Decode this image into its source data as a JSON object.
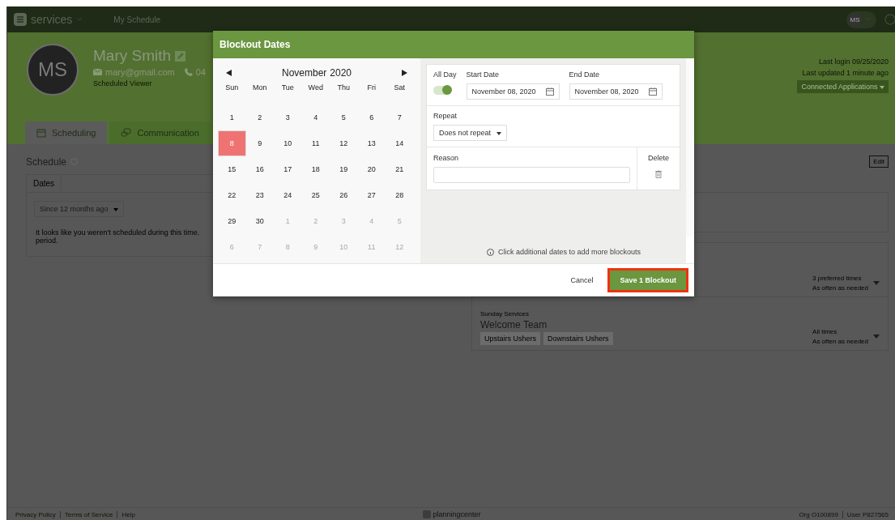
{
  "nav": {
    "app_name": "services",
    "link": "My Schedule",
    "avatar": "MS"
  },
  "profile": {
    "initials": "MS",
    "name": "Mary Smith",
    "email": "mary@gmail.com",
    "phone": "04",
    "role": "Scheduled Viewer",
    "last_login": "Last login 09/25/2020",
    "last_updated": "Last updated 1 minute ago",
    "apps_button": "Connected Applications"
  },
  "tabs": [
    {
      "label": "Scheduling",
      "selected": true
    },
    {
      "label": "Communication",
      "selected": false
    }
  ],
  "schedule": {
    "title": "Schedule",
    "edit": "Edit",
    "dates_tab": "Dates",
    "range": "Since 12 months ago",
    "empty_lines": [
      "It looks like you weren't scheduled during this time.",
      "period."
    ]
  },
  "teams": [
    {
      "times": "3 preferred times",
      "frequency": "As often as needed"
    },
    {
      "service": "Sunday Services",
      "name": "Welcome Team",
      "positions": [
        "Upstairs Ushers",
        "Downstairs Ushers"
      ],
      "times": "All times",
      "frequency": "As often as needed"
    }
  ],
  "footer": {
    "links": [
      "Privacy Policy",
      "Terms of Service",
      "Help"
    ],
    "brand": "planningcenter",
    "org": "Org O100899",
    "user": "User P827565"
  },
  "modal": {
    "title": "Blockout Dates",
    "calendar": {
      "month": "November",
      "year": "2020",
      "weekdays": [
        "Sun",
        "Mon",
        "Tue",
        "Wed",
        "Thu",
        "Fri",
        "Sat"
      ],
      "weeks": [
        [
          {
            "label": "1",
            "muted": false,
            "selected": false
          },
          {
            "label": "2",
            "muted": false,
            "selected": false
          },
          {
            "label": "3",
            "muted": false,
            "selected": false
          },
          {
            "label": "4",
            "muted": false,
            "selected": false
          },
          {
            "label": "5",
            "muted": false,
            "selected": false
          },
          {
            "label": "6",
            "muted": false,
            "selected": false
          },
          {
            "label": "7",
            "muted": false,
            "selected": false
          }
        ],
        [
          {
            "label": "8",
            "muted": false,
            "selected": true
          },
          {
            "label": "9",
            "muted": false,
            "selected": false
          },
          {
            "label": "10",
            "muted": false,
            "selected": false
          },
          {
            "label": "11",
            "muted": false,
            "selected": false
          },
          {
            "label": "12",
            "muted": false,
            "selected": false
          },
          {
            "label": "13",
            "muted": false,
            "selected": false
          },
          {
            "label": "14",
            "muted": false,
            "selected": false
          }
        ],
        [
          {
            "label": "15",
            "muted": false,
            "selected": false
          },
          {
            "label": "16",
            "muted": false,
            "selected": false
          },
          {
            "label": "17",
            "muted": false,
            "selected": false
          },
          {
            "label": "18",
            "muted": false,
            "selected": false
          },
          {
            "label": "19",
            "muted": false,
            "selected": false
          },
          {
            "label": "20",
            "muted": false,
            "selected": false
          },
          {
            "label": "21",
            "muted": false,
            "selected": false
          }
        ],
        [
          {
            "label": "22",
            "muted": false,
            "selected": false
          },
          {
            "label": "23",
            "muted": false,
            "selected": false
          },
          {
            "label": "24",
            "muted": false,
            "selected": false
          },
          {
            "label": "25",
            "muted": false,
            "selected": false
          },
          {
            "label": "26",
            "muted": false,
            "selected": false
          },
          {
            "label": "27",
            "muted": false,
            "selected": false
          },
          {
            "label": "28",
            "muted": false,
            "selected": false
          }
        ],
        [
          {
            "label": "29",
            "muted": false,
            "selected": false
          },
          {
            "label": "30",
            "muted": false,
            "selected": false
          },
          {
            "label": "1",
            "muted": true,
            "selected": false
          },
          {
            "label": "2",
            "muted": true,
            "selected": false
          },
          {
            "label": "3",
            "muted": true,
            "selected": false
          },
          {
            "label": "4",
            "muted": true,
            "selected": false
          },
          {
            "label": "5",
            "muted": true,
            "selected": false
          }
        ],
        [
          {
            "label": "6",
            "muted": true,
            "selected": false
          },
          {
            "label": "7",
            "muted": true,
            "selected": false
          },
          {
            "label": "8",
            "muted": true,
            "selected": false
          },
          {
            "label": "9",
            "muted": true,
            "selected": false
          },
          {
            "label": "10",
            "muted": true,
            "selected": false
          },
          {
            "label": "11",
            "muted": true,
            "selected": false
          },
          {
            "label": "12",
            "muted": true,
            "selected": false
          }
        ]
      ]
    },
    "all_day": {
      "label": "All Day",
      "on": true
    },
    "start_date": {
      "label": "Start Date",
      "value": "November 08, 2020"
    },
    "end_date": {
      "label": "End Date",
      "value": "November 08, 2020"
    },
    "repeat": {
      "label": "Repeat",
      "value": "Does not repeat"
    },
    "reason": {
      "label": "Reason"
    },
    "delete_label": "Delete",
    "hint": "Click additional dates to add more blockouts",
    "cancel": "Cancel",
    "save": "Save 1 Blockout"
  }
}
